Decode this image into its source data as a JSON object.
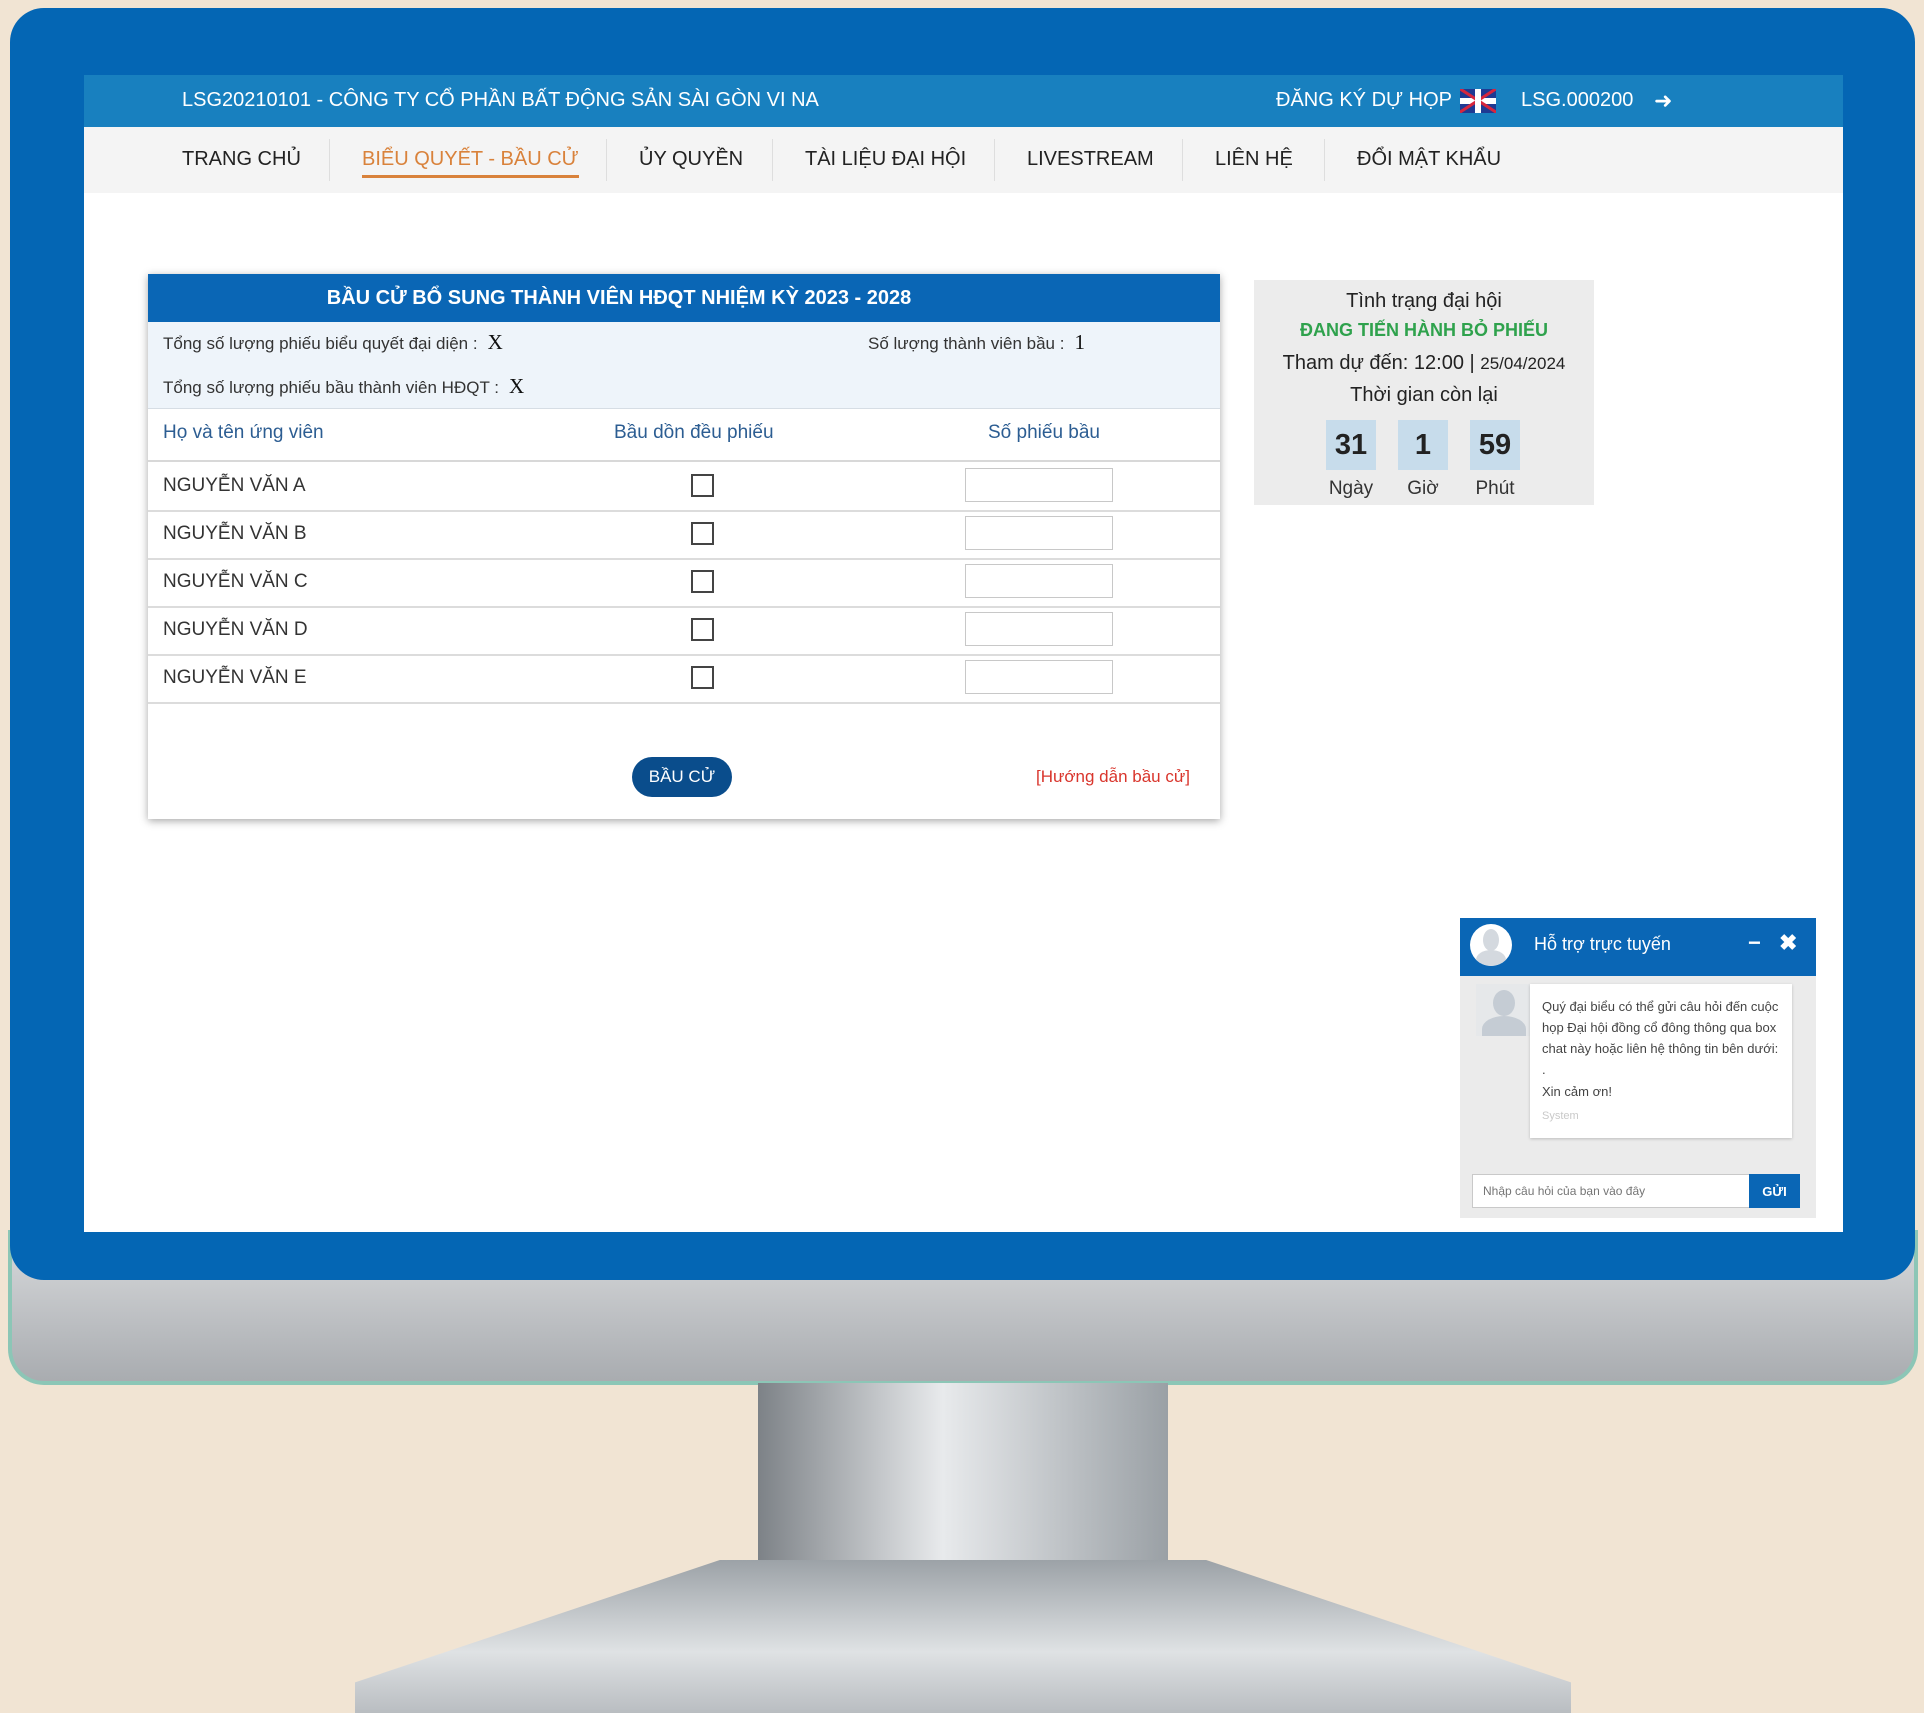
{
  "header": {
    "company": "LSG20210101 - CÔNG TY CỔ PHẦN BẤT ĐỘNG SẢN SÀI GÒN VI NA",
    "register_label": "ĐĂNG KÝ DỰ HỌP",
    "account": "LSG.000200",
    "language_icon": "uk-flag-icon",
    "logout_icon": "logout-icon"
  },
  "nav": {
    "items": [
      "TRANG CHỦ",
      "BIỂU QUYẾT - BẦU CỬ",
      "ỦY QUYỀN",
      "TÀI LIỆU ĐẠI HỘI",
      "LIVESTREAM",
      "LIÊN HỆ",
      "ĐỔI MẬT KHẨU"
    ],
    "active": "BIỂU QUYẾT - BẦU CỬ"
  },
  "ballot": {
    "title": "BẦU CỬ BỔ SUNG THÀNH VIÊN HĐQT NHIỆM KỲ 2023 - 2028",
    "total_voting_label": "Tổng số lượng phiếu biểu quyết đại diện :",
    "total_voting_value": "X",
    "members_to_elect_label": "Số lượng thành viên bầu :",
    "members_to_elect_value": "1",
    "total_ballot_label": "Tổng số lượng phiếu bầu thành viên HĐQT :",
    "total_ballot_value": "X",
    "columns": [
      "Họ và tên ứng viên",
      "Bầu dồn đều phiếu",
      "Số phiếu bầu"
    ],
    "candidates": [
      {
        "name": "NGUYỄN VĂN A",
        "checked": false,
        "votes": ""
      },
      {
        "name": "NGUYỄN VĂN B",
        "checked": false,
        "votes": ""
      },
      {
        "name": "NGUYỄN VĂN C",
        "checked": false,
        "votes": ""
      },
      {
        "name": "NGUYỄN VĂN D",
        "checked": false,
        "votes": ""
      },
      {
        "name": "NGUYỄN VĂN E",
        "checked": false,
        "votes": ""
      }
    ],
    "submit_label": "BẦU CỬ",
    "guide_label": "[Hướng dẫn bầu cử]"
  },
  "status": {
    "title": "Tình trạng đại hội",
    "state": "ĐANG TIẾN HÀNH BỎ PHIẾU",
    "attend_label": "Tham dự đến:",
    "attend_time": "12:00",
    "attend_date": "25/04/2024",
    "remaining_label": "Thời gian còn lại",
    "countdown": {
      "days": "31",
      "hours": "1",
      "minutes": "59"
    },
    "countdown_labels": {
      "days": "Ngày",
      "hours": "Giờ",
      "minutes": "Phút"
    }
  },
  "chat": {
    "title": "Hỗ trợ trực tuyến",
    "minimize": "−",
    "close": "✖",
    "message": "Quý đại biểu có thể gửi câu hỏi đến cuộc họp Đại hội đồng cổ đông thông qua box chat này hoặc liên hệ thông tin bên dưới: .",
    "thanks": "Xin cảm ơn!",
    "sender": "System",
    "input_placeholder": "Nhập câu hỏi của bạn vào đây",
    "send_label": "GỬI"
  },
  "colors": {
    "monitor_blue": "#0466b4",
    "header_blue": "#1880bf",
    "active_tab": "#d9823b",
    "status_green": "#2fa24d",
    "guide_red": "#d9352c"
  }
}
